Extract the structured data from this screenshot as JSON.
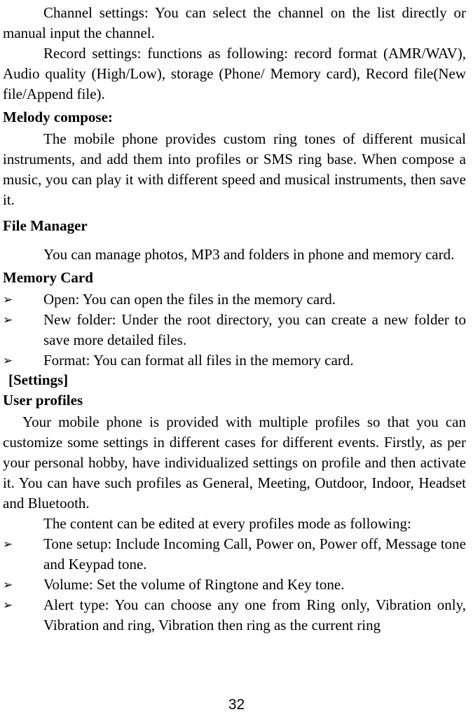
{
  "p_channel": "Channel settings: You can select the channel on the list directly or manual input the channel.",
  "p_record": "Record settings: functions as following: record format (AMR/WAV), Audio quality (High/Low), storage (Phone/ Memory card), Record file(New file/Append file).",
  "h_melody": "Melody compose:",
  "p_melody": "The mobile phone provides custom ring tones of different musical instruments, and add them into profiles or SMS ring base. When compose a music, you can play it with different speed and musical instruments, then save it.",
  "h_file": "File Manager",
  "p_file": "You can manage photos, MP3 and folders in phone and memory card.",
  "h_memory": "Memory Card",
  "mem_open": "Open: You can open the files in the memory card.",
  "mem_new": "New folder: Under the root directory, you can create a new folder to save more detailed files.",
  "mem_format": "Format: You can format all files in the memory card.",
  "h_settings": "[Settings]",
  "h_user": "User profiles",
  "p_user1": "Your mobile phone is provided with multiple profiles so that you can customize some settings in different cases for different events. Firstly, as per your personal hobby, have individualized settings on profile and then activate it. You can have such profiles as General, Meeting, Outdoor, Indoor, Headset and Bluetooth.",
  "p_user2": "The content can be edited at every profiles mode as following:",
  "prof_tone": "Tone setup: Include Incoming Call, Power on, Power off, Message tone and Keypad tone.",
  "prof_vol": "Volume: Set the volume of Ringtone and Key tone.",
  "prof_alert": "Alert type: You can choose any one from Ring only, Vibration only, Vibration and ring, Vibration then ring as the current ring",
  "page_number": "32"
}
